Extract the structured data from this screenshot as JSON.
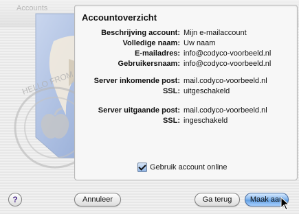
{
  "window": {
    "title": "Accounts"
  },
  "panel": {
    "title": "Accountoverzicht",
    "rows": [
      {
        "label": "Beschrijving account:",
        "value": "Mijn e-mailaccount"
      },
      {
        "label": "Volledige naam:",
        "value": "Uw naam"
      },
      {
        "label": "E-mailadres:",
        "value": "info@codyco-voorbeeld.nl"
      },
      {
        "label": "Gebruikersnaam:",
        "value": "info@codyco-voorbeeld.nl"
      },
      {
        "label": "Server inkomende post:",
        "value": "mail.codyco-voorbeeld.nl"
      },
      {
        "label": "SSL:",
        "value": "uitgeschakeld"
      },
      {
        "label": "Server uitgaande post:",
        "value": "mail.codyco-voorbeeld.nl"
      },
      {
        "label": "SSL:",
        "value": "ingeschakeld"
      }
    ],
    "online_checkbox": {
      "label": "Gebruik account online",
      "checked": true
    }
  },
  "buttons": {
    "help": "?",
    "cancel": "Annuleer",
    "back": "Ga terug",
    "create": "Maak aan"
  },
  "stamp": {
    "text": "HELLO FROM CUPERTINO, CA"
  },
  "colors": {
    "primary_button": "#5c9be0",
    "panel_bg": "#f7f7f7"
  }
}
